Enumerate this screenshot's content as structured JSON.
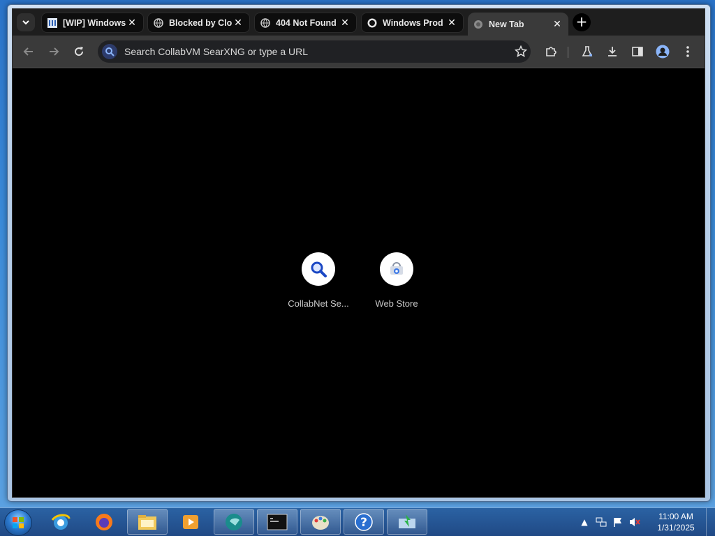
{
  "window": {
    "caption_buttons": {
      "minimize": "▁",
      "maximize": "□",
      "close": "✕"
    }
  },
  "browser": {
    "tabs": [
      {
        "title": "[WIP] Windows",
        "icon": "wiki-icon",
        "close": "✕"
      },
      {
        "title": "Blocked by Clo",
        "icon": "globe-icon",
        "close": "✕"
      },
      {
        "title": "404 Not Found",
        "icon": "globe-icon",
        "close": "✕"
      },
      {
        "title": "Windows Prod",
        "icon": "github-icon",
        "close": "✕"
      },
      {
        "title": "New Tab",
        "icon": "globe-icon",
        "close": "✕",
        "active": true
      }
    ],
    "new_tab_label": "+",
    "omnibox": {
      "placeholder": "Search CollabVM SearXNG or type a URL"
    },
    "shortcuts": [
      {
        "label": "CollabNet Se...",
        "icon": "search-icon"
      },
      {
        "label": "Web Store",
        "icon": "web-store-icon"
      }
    ]
  },
  "taskbar": {
    "pinned": [
      "internet-explorer-icon",
      "firefox-icon",
      "file-explorer-icon",
      "media-player-icon",
      "app-icon",
      "command-prompt-icon",
      "paint-icon",
      "help-icon",
      "network-app-icon"
    ],
    "clock": {
      "time": "11:00 AM",
      "date": "1/31/2025"
    }
  },
  "colors": {
    "accent": "#8ab4f8",
    "tab_active": "#3a3a3a",
    "toolbar": "#3a3a3a",
    "taskbar": "#285fa0"
  }
}
